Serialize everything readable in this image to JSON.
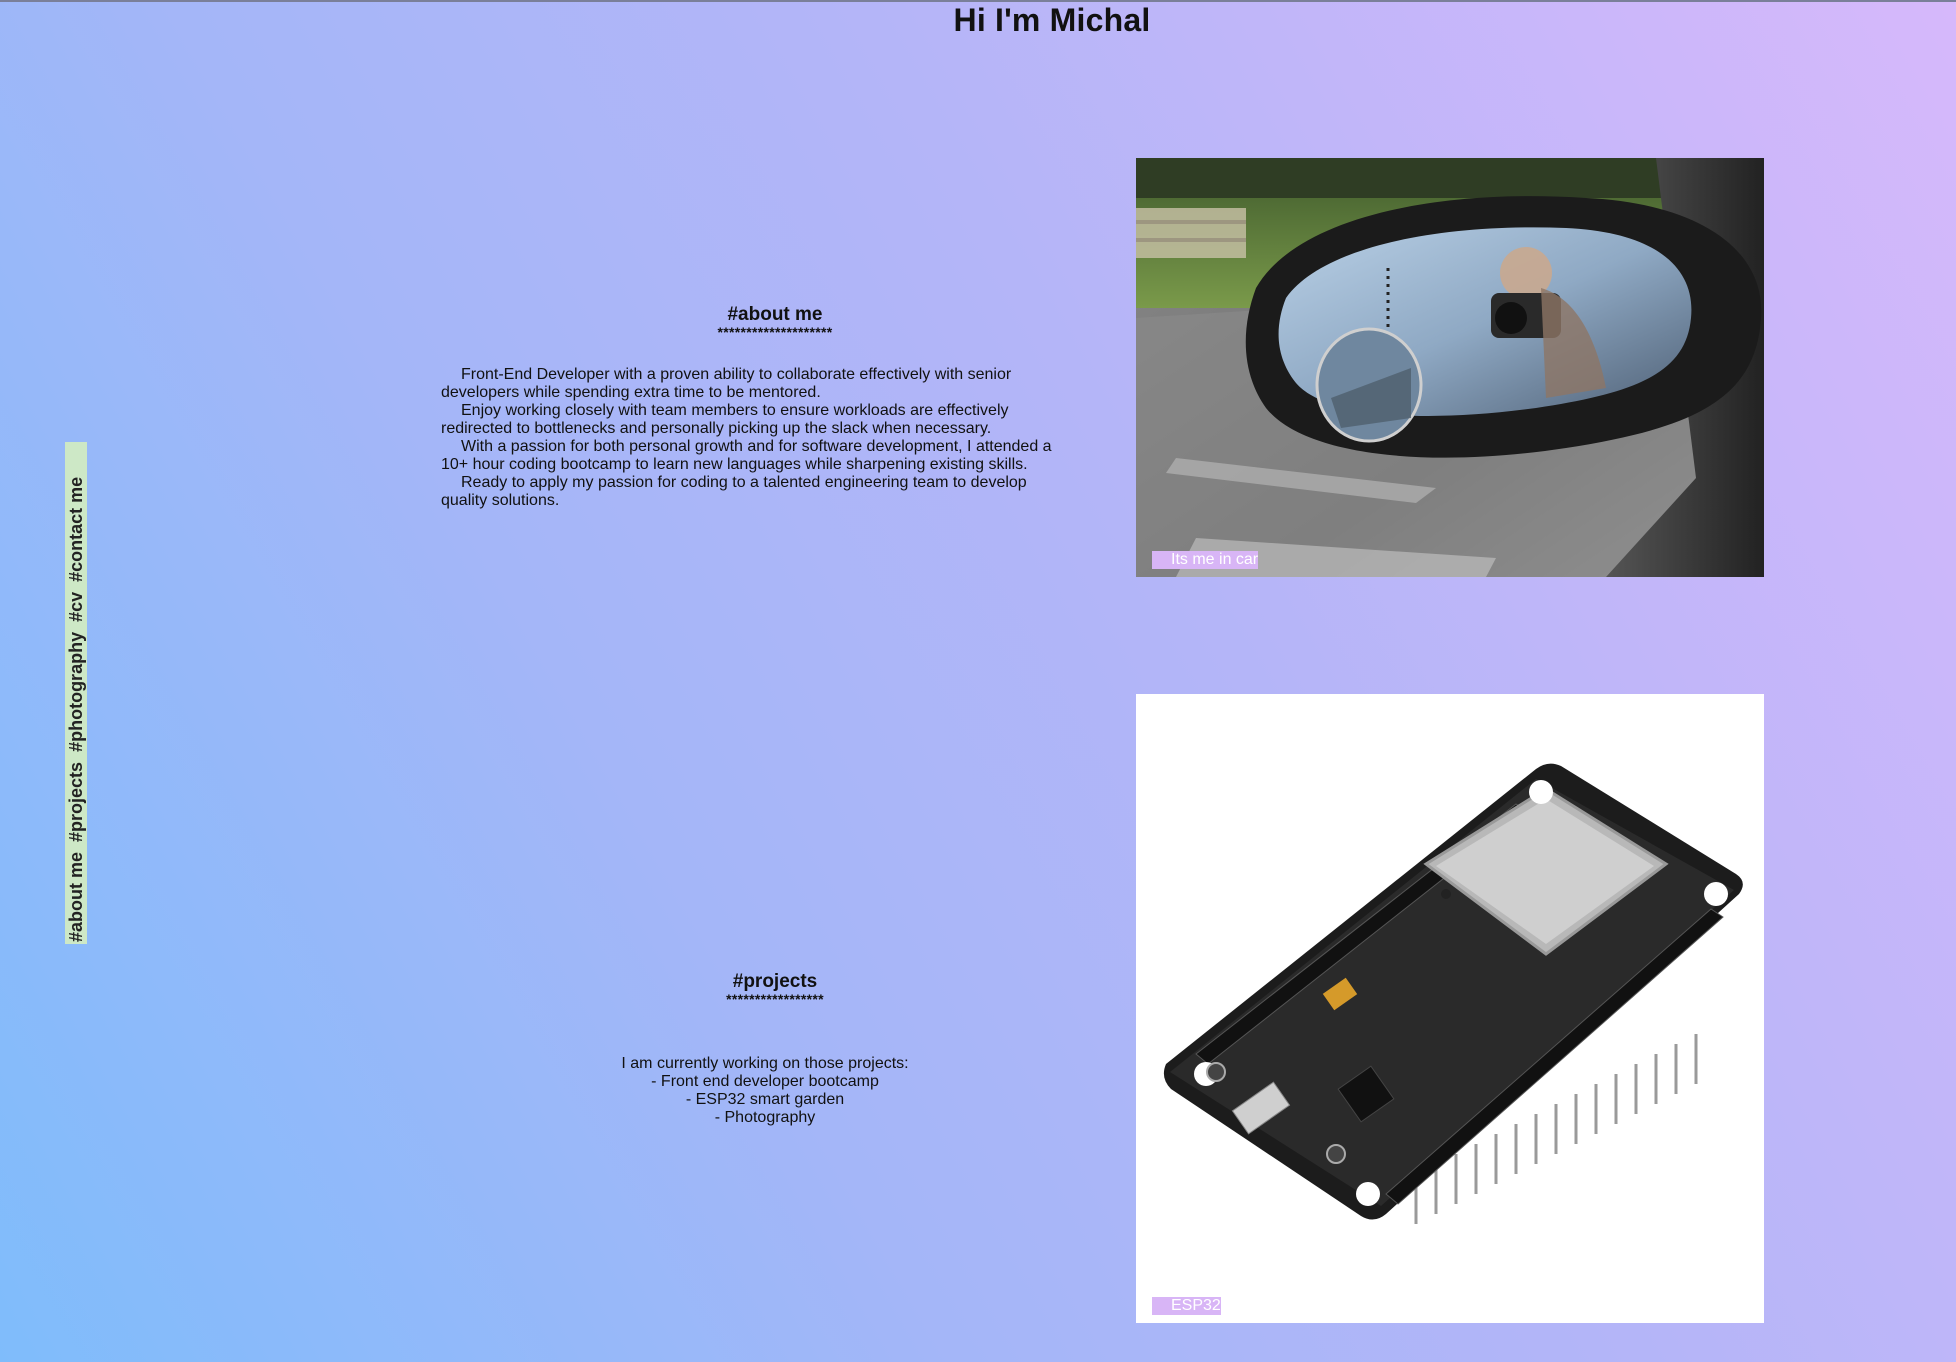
{
  "page": {
    "title": "Hi I'm Michal"
  },
  "nav": {
    "items": [
      {
        "label": "#about me"
      },
      {
        "label": "#projects"
      },
      {
        "label": "#photography"
      },
      {
        "label": "#cv"
      },
      {
        "label": "#contact me"
      }
    ],
    "background": "#cde8c6"
  },
  "about": {
    "heading": "#about me",
    "divider": "********************",
    "paragraphs": [
      "Front-End Developer with a proven ability to collaborate effectively with senior developers while spending extra time to be mentored.",
      "Enjoy working closely with team members to ensure workloads are effectively redirected to bottlenecks and personally picking up the slack when necessary.",
      "With a passion for both personal growth and for software development, I attended a 10+ hour coding bootcamp to learn new languages while sharpening existing skills.",
      "Ready to apply my passion for coding to a talented engineering team to develop quality solutions."
    ]
  },
  "projects": {
    "heading": "#projects",
    "divider": "*****************",
    "intro": "I am currently working on those projects:",
    "items": [
      "- Front end developer bootcamp",
      "- ESP32 smart garden",
      "- Photography"
    ]
  },
  "photos": {
    "car_caption": "Its me in car",
    "esp_caption": "ESP32"
  },
  "colors": {
    "gradient_start": "#7fbcfb",
    "gradient_end": "#d6b8fb",
    "caption_bg": "#d8b5f6"
  }
}
